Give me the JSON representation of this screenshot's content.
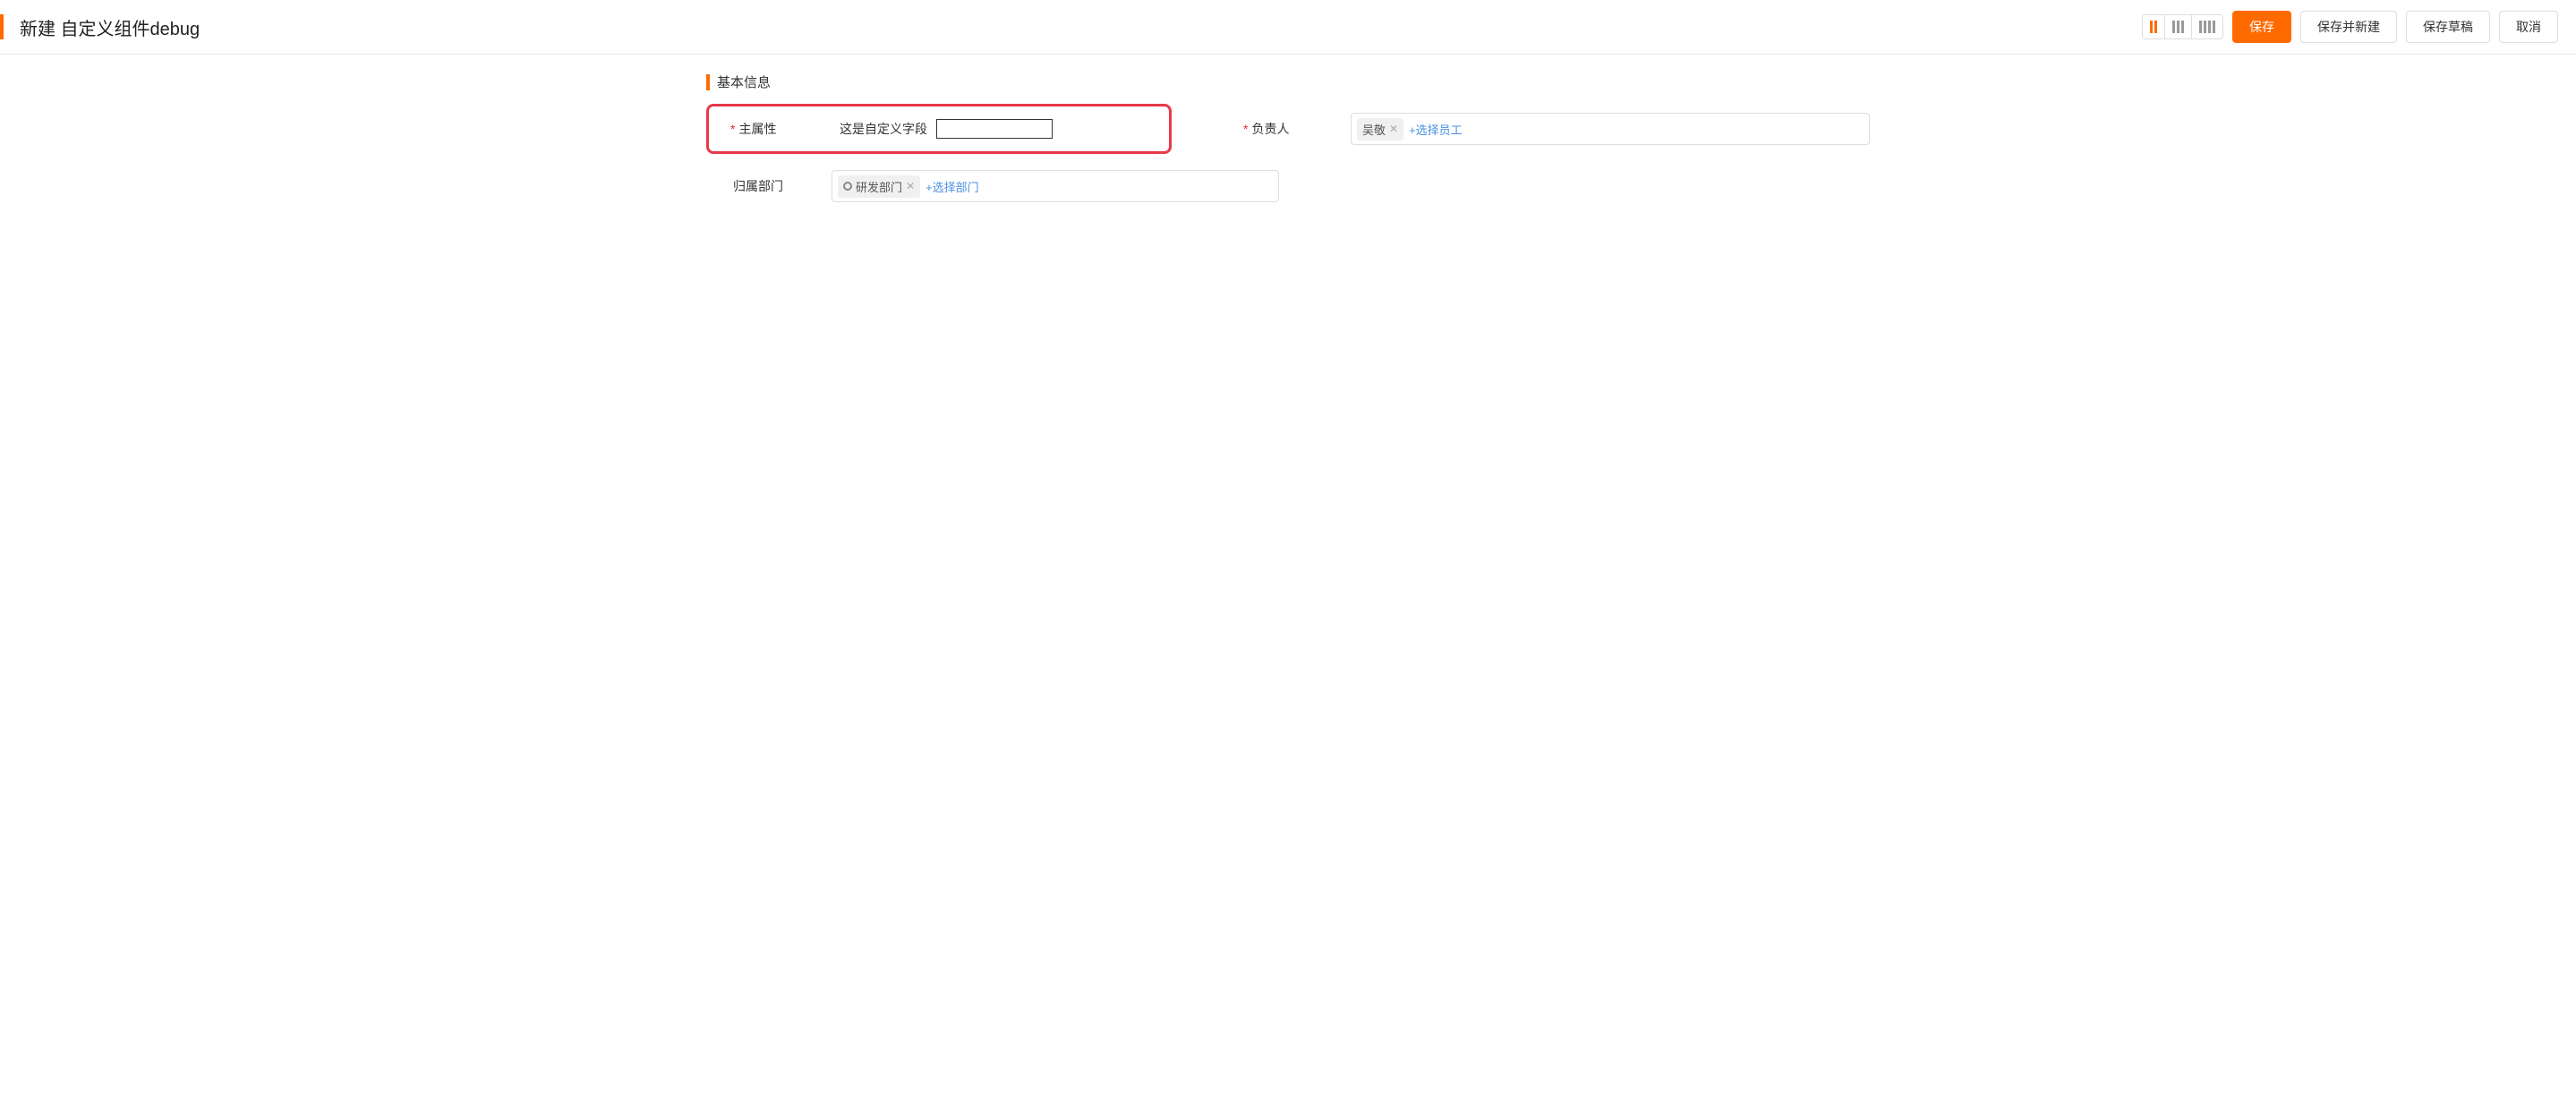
{
  "header": {
    "title": "新建 自定义组件debug",
    "buttons": {
      "save": "保存",
      "save_and_new": "保存并新建",
      "save_draft": "保存草稿",
      "cancel": "取消"
    }
  },
  "section": {
    "title": "基本信息"
  },
  "fields": {
    "main_property": {
      "label": "主属性",
      "prefix": "这是自定义字段"
    },
    "owner": {
      "label": "负责人",
      "tag": "吴敬",
      "add_link": "+选择员工"
    },
    "department": {
      "label": "归属部门",
      "tag": "研发部门",
      "add_link": "+选择部门"
    }
  }
}
